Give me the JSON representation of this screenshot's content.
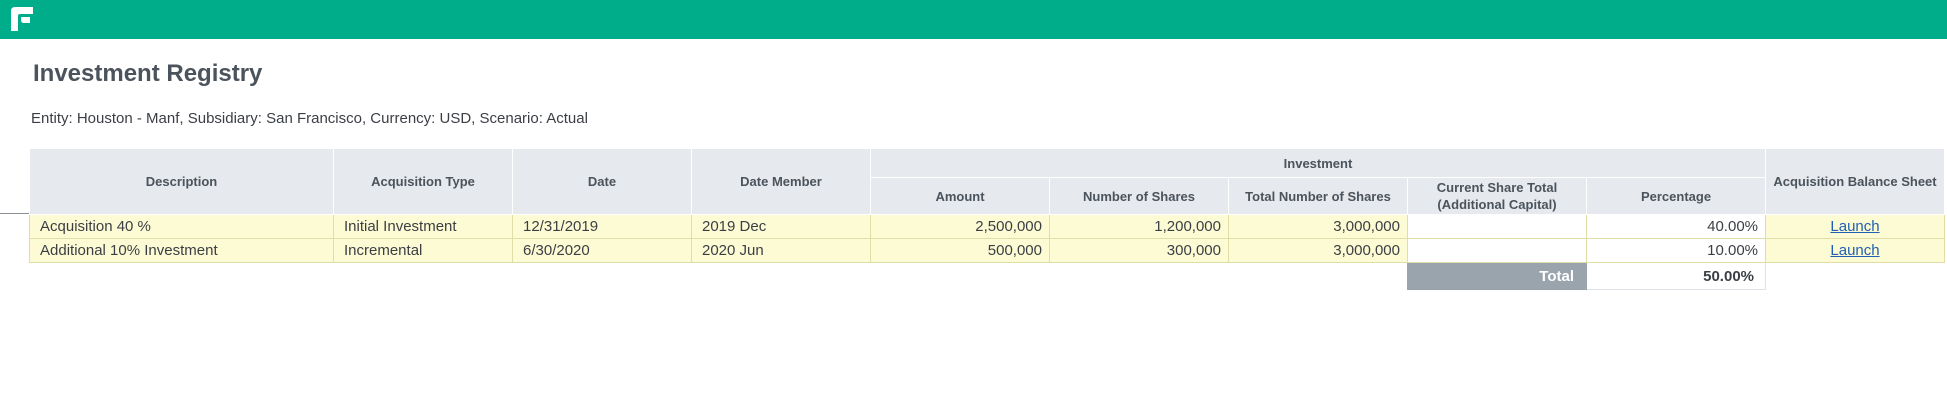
{
  "page": {
    "title": "Investment Registry",
    "subtitle": "Entity: Houston - Manf, Subsidiary: San Francisco, Currency: USD, Scenario: Actual"
  },
  "theme": {
    "topbar": "#00ad8a",
    "link": "#1f5fb4",
    "row_fill": "#fdfbd3",
    "total_fill": "#9aa4ad"
  },
  "logo_icon": "planful-logo-icon",
  "table": {
    "group_header": "Investment",
    "headers": {
      "description": "Description",
      "acquisition_type": "Acquisition Type",
      "date": "Date",
      "date_member": "Date Member",
      "amount": "Amount",
      "number_of_shares": "Number of Shares",
      "total_number_of_shares": "Total Number of Shares",
      "current_share_total_line1": "Current Share Total",
      "current_share_total_line2": "(Additional Capital)",
      "percentage": "Percentage",
      "acquisition_balance_sheet": "Acquisition Balance Sheet"
    },
    "rows": [
      {
        "description": "Acquisition 40 %",
        "acquisition_type": "Initial Investment",
        "date": "12/31/2019",
        "date_member": "2019 Dec",
        "amount": "2,500,000",
        "number_of_shares": "1,200,000",
        "total_number_of_shares": "3,000,000",
        "current_share_total": "",
        "percentage": "40.00%",
        "action": "Launch"
      },
      {
        "description": "Additional 10% Investment",
        "acquisition_type": "Incremental",
        "date": "6/30/2020",
        "date_member": "2020 Jun",
        "amount": "500,000",
        "number_of_shares": "300,000",
        "total_number_of_shares": "3,000,000",
        "current_share_total": "",
        "percentage": "10.00%",
        "action": "Launch"
      }
    ],
    "total": {
      "label": "Total",
      "value": "50.00%"
    }
  }
}
